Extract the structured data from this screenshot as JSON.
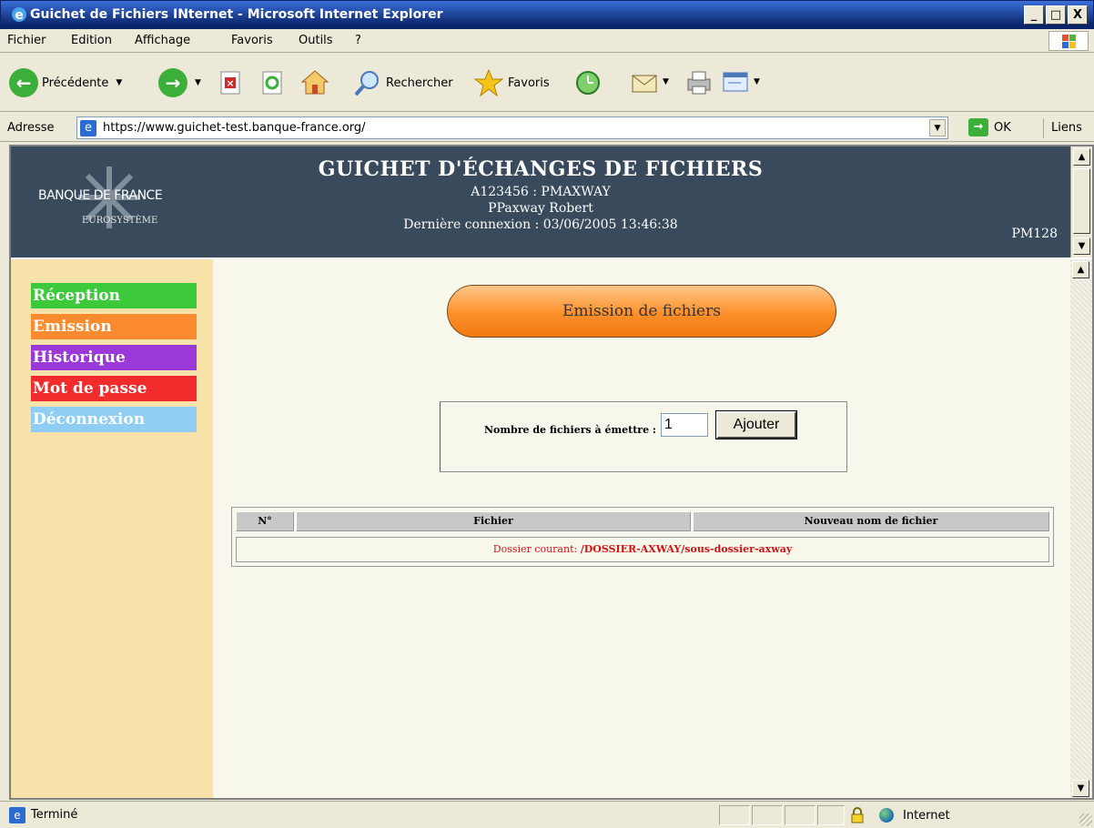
{
  "window": {
    "title": "Guichet de Fichiers INternet - Microsoft Internet Explorer",
    "buttons": [
      "_",
      "□",
      "X"
    ]
  },
  "menu": [
    "Fichier",
    "Edition",
    "Affichage",
    "Favoris",
    "Outils",
    "?"
  ],
  "toolbar": {
    "back_label": "Précédente",
    "search_label": "Rechercher",
    "favorites_label": "Favoris"
  },
  "address": {
    "label": "Adresse",
    "url": "https://www.guichet-test.banque-france.org/",
    "go_label": "OK",
    "links_label": "Liens"
  },
  "header": {
    "logo_name": "BANQUE DE FRANCE",
    "logo_sub": "EUROSYSTÈME",
    "title": "GUICHET D'ÉCHANGES DE FICHIERS",
    "account": "A123456 : PMAXWAY",
    "user": "PPaxway Robert",
    "last_login": "Dernière connexion : 03/06/2005 13:46:38",
    "code": "PM128"
  },
  "nav": [
    {
      "label": "Réception",
      "color": "#3cc93a"
    },
    {
      "label": "Emission",
      "color": "#fc8a2e"
    },
    {
      "label": "Historique",
      "color": "#9a38d8"
    },
    {
      "label": "Mot de passe",
      "color": "#f22c2c"
    },
    {
      "label": "Déconnexion",
      "color": "#8fcdf5"
    }
  ],
  "main": {
    "section_title": "Emission de fichiers",
    "count_label": "Nombre de fichiers à émettre :",
    "count_value": "1",
    "add_button": "Ajouter",
    "table": {
      "headers": [
        "N°",
        "Fichier",
        "Nouveau nom de fichier"
      ],
      "folder_prefix": "Dossier courant: ",
      "folder_path": "/DOSSIER-AXWAY/",
      "folder_sub": "sous-dossier-axway"
    }
  },
  "status": {
    "text": "Terminé",
    "zone": "Internet"
  }
}
